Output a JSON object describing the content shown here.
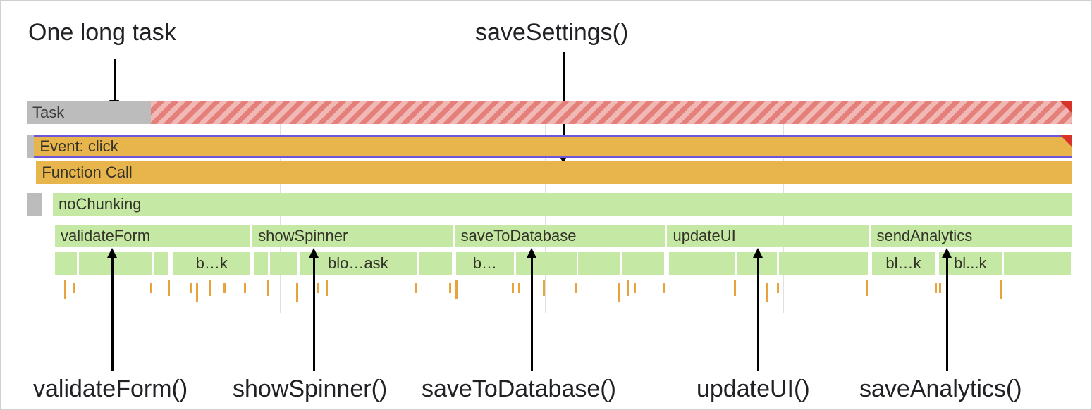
{
  "annotations": {
    "top_left": "One long task",
    "top_right": "saveSettings()",
    "bottom": {
      "validateForm": "validateForm()",
      "showSpinner": "showSpinner()",
      "saveToDatabase": "saveToDatabase()",
      "updateUI": "updateUI()",
      "saveAnalytics": "saveAnalytics()"
    }
  },
  "rows": {
    "task": {
      "label": "Task",
      "color_fast": "#bcbcbc",
      "color_slow": "#e57f7a",
      "split_pct": 11.9
    },
    "event": {
      "label": "Event: click",
      "color": "#e8b44c",
      "border": "#6f55d9"
    },
    "function_call": {
      "label": "Function Call",
      "color": "#e8b44c"
    },
    "no_chunking": {
      "label": "noChunking",
      "color": "#c5e9a5"
    },
    "child_calls": [
      {
        "name": "validateForm",
        "start_pct": 2.7,
        "width_pct": 18.7
      },
      {
        "name": "showSpinner",
        "start_pct": 21.6,
        "width_pct": 19.2
      },
      {
        "name": "saveToDatabase",
        "start_pct": 41.0,
        "width_pct": 20.1
      },
      {
        "name": "updateUI",
        "start_pct": 61.3,
        "width_pct": 19.3
      },
      {
        "name": "sendAnalytics",
        "start_pct": 80.8,
        "width_pct": 19.2
      }
    ],
    "micro_blocks": [
      {
        "label": "",
        "start_pct": 2.7,
        "width_pct": 2.1
      },
      {
        "label": "",
        "start_pct": 5.0,
        "width_pct": 7.0
      },
      {
        "label": "",
        "start_pct": 12.2,
        "width_pct": 1.3
      },
      {
        "label": "b…k",
        "start_pct": 14.0,
        "width_pct": 7.4
      },
      {
        "label": "",
        "start_pct": 21.7,
        "width_pct": 1.4
      },
      {
        "label": "",
        "start_pct": 23.3,
        "width_pct": 2.6
      },
      {
        "label": "blo…ask",
        "start_pct": 26.1,
        "width_pct": 11.2
      },
      {
        "label": "",
        "start_pct": 37.5,
        "width_pct": 3.2
      },
      {
        "label": "b…",
        "start_pct": 41.1,
        "width_pct": 5.5
      },
      {
        "label": "",
        "start_pct": 46.8,
        "width_pct": 5.8
      },
      {
        "label": "",
        "start_pct": 52.8,
        "width_pct": 4.0
      },
      {
        "label": "",
        "start_pct": 57.0,
        "width_pct": 4.0
      },
      {
        "label": "",
        "start_pct": 61.5,
        "width_pct": 6.3
      },
      {
        "label": "",
        "start_pct": 68.0,
        "width_pct": 3.8
      },
      {
        "label": "",
        "start_pct": 72.0,
        "width_pct": 8.5
      },
      {
        "label": "bl…k",
        "start_pct": 80.9,
        "width_pct": 6.0
      },
      {
        "label": "bl...k",
        "start_pct": 87.3,
        "width_pct": 6.0
      },
      {
        "label": "",
        "start_pct": 93.5,
        "width_pct": 6.4
      }
    ],
    "ticks_pct": [
      3.6,
      4.4,
      11.8,
      13.5,
      15.6,
      16.2,
      17.4,
      18.8,
      20.8,
      23.0,
      25.8,
      27.8,
      28.6,
      37.2,
      40.4,
      41.0,
      46.4,
      47.0,
      49.4,
      52.4,
      56.6,
      57.4,
      58.1,
      60.9,
      67.7,
      70.7,
      71.8,
      80.3,
      86.9,
      87.3,
      93.2
    ]
  },
  "colors": {
    "green": "#c5e9a5",
    "orange": "#e8b44c",
    "grey": "#bcbcbc",
    "red_stripe": "#e57f7a",
    "red_corner": "#d8332a",
    "purple": "#6f55d9"
  }
}
